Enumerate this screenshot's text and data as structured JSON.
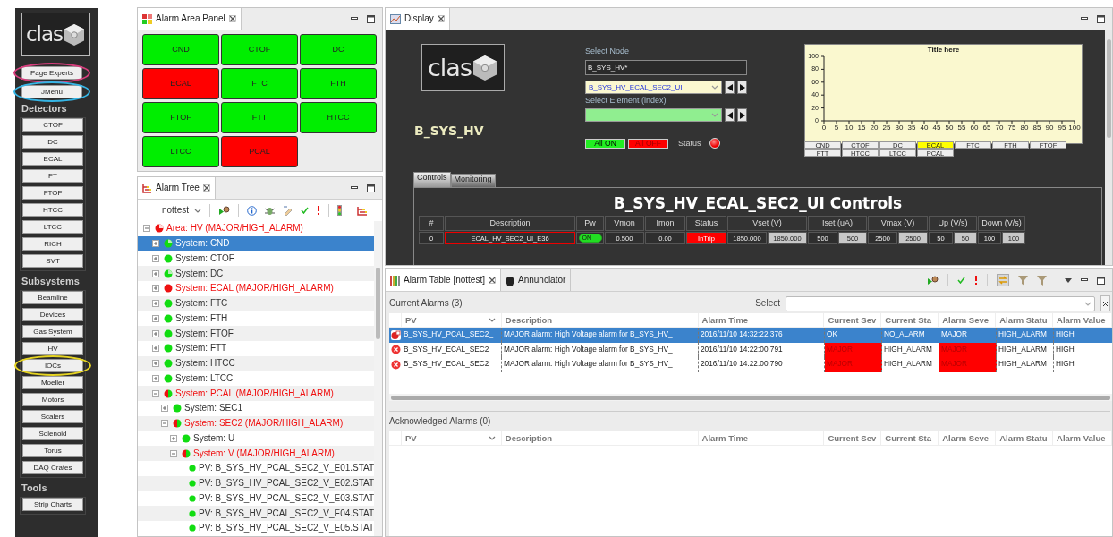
{
  "sidebar": {
    "logo": "clas",
    "buttons": [
      {
        "label": "Page Experts",
        "color": "#d63d7c"
      },
      {
        "label": "JMenu",
        "color": "#35b5e5"
      }
    ],
    "groups": [
      {
        "title": "Detectors",
        "buttons": [
          {
            "label": "CTOF"
          },
          {
            "label": "DC"
          },
          {
            "label": "ECAL"
          },
          {
            "label": "FT"
          },
          {
            "label": "FTOF"
          },
          {
            "label": "HTCC"
          },
          {
            "label": "LTCC"
          },
          {
            "label": "RICH"
          },
          {
            "label": "SVT"
          }
        ]
      },
      {
        "title": "Subsystems",
        "buttons": [
          {
            "label": "Beamline"
          },
          {
            "label": "Devices"
          },
          {
            "label": "Gas System"
          },
          {
            "label": "HV"
          },
          {
            "label": "IOCs",
            "color": "#e6d422"
          },
          {
            "label": "Moeller"
          },
          {
            "label": "Motors"
          },
          {
            "label": "Scalers"
          },
          {
            "label": "Solenoid"
          },
          {
            "label": "Torus"
          },
          {
            "label": "DAQ Crates"
          }
        ]
      },
      {
        "title": "Tools",
        "buttons": [
          {
            "label": "Strip Charts"
          }
        ]
      }
    ]
  },
  "alarm_area_panel": {
    "title": "Alarm Area Panel",
    "areas": [
      {
        "label": "CND",
        "alarm": false
      },
      {
        "label": "CTOF",
        "alarm": false
      },
      {
        "label": "DC",
        "alarm": false
      },
      {
        "label": "ECAL",
        "alarm": true
      },
      {
        "label": "FTC",
        "alarm": false
      },
      {
        "label": "FTH",
        "alarm": false
      },
      {
        "label": "FTOF",
        "alarm": false
      },
      {
        "label": "FTT",
        "alarm": false
      },
      {
        "label": "HTCC",
        "alarm": false
      },
      {
        "label": "LTCC",
        "alarm": false
      },
      {
        "label": "PCAL",
        "alarm": true
      }
    ]
  },
  "alarm_tree": {
    "title": "Alarm Tree",
    "config": "nottest",
    "items": [
      {
        "label": "Area: HV (MAJOR/HIGH_ALARM)",
        "kind": "major_partial",
        "alarm": true,
        "expanded": true,
        "selected": false,
        "children": [
          {
            "label": "System: CND",
            "kind": "ok_partial",
            "alarm": false,
            "expanded": false,
            "selected": true
          },
          {
            "label": "System: CTOF",
            "kind": "ok",
            "alarm": false,
            "expanded": false,
            "selected": false
          },
          {
            "label": "System: DC",
            "kind": "ok_partial",
            "alarm": false,
            "expanded": false,
            "selected": false
          },
          {
            "label": "System: ECAL (MAJOR/HIGH_ALARM)",
            "kind": "major",
            "alarm": true,
            "expanded": false,
            "selected": false
          },
          {
            "label": "System: FTC",
            "kind": "ok",
            "alarm": false,
            "expanded": false,
            "selected": false
          },
          {
            "label": "System: FTH",
            "kind": "ok",
            "alarm": false,
            "expanded": false,
            "selected": false
          },
          {
            "label": "System: FTOF",
            "kind": "ok",
            "alarm": false,
            "expanded": false,
            "selected": false
          },
          {
            "label": "System: FTT",
            "kind": "ok",
            "alarm": false,
            "expanded": false,
            "selected": false
          },
          {
            "label": "System: HTCC",
            "kind": "ok",
            "alarm": false,
            "expanded": false,
            "selected": false
          },
          {
            "label": "System: LTCC",
            "kind": "ok",
            "alarm": false,
            "expanded": false,
            "selected": false
          },
          {
            "label": "System: PCAL (MAJOR/HIGH_ALARM)",
            "kind": "mixed",
            "alarm": true,
            "expanded": true,
            "selected": false,
            "children": [
              {
                "label": "System: SEC1",
                "kind": "ok",
                "alarm": false,
                "expanded": false,
                "selected": false
              },
              {
                "label": "System: SEC2 (MAJOR/HIGH_ALARM)",
                "kind": "mixed",
                "alarm": true,
                "expanded": true,
                "selected": false,
                "children": [
                  {
                    "label": "System: U",
                    "kind": "ok",
                    "alarm": false,
                    "expanded": false,
                    "selected": false
                  },
                  {
                    "label": "System: V (MAJOR/HIGH_ALARM)",
                    "kind": "mixed",
                    "alarm": true,
                    "expanded": true,
                    "selected": false,
                    "children": [
                      {
                        "label": "PV: B_SYS_HV_PCAL_SEC2_V_E01.STAT",
                        "kind": "ok",
                        "alarm": false,
                        "selected": false
                      },
                      {
                        "label": "PV: B_SYS_HV_PCAL_SEC2_V_E02.STAT",
                        "kind": "ok",
                        "alarm": false,
                        "selected": false
                      },
                      {
                        "label": "PV: B_SYS_HV_PCAL_SEC2_V_E03.STAT",
                        "kind": "ok",
                        "alarm": false,
                        "selected": false
                      },
                      {
                        "label": "PV: B_SYS_HV_PCAL_SEC2_V_E04.STAT",
                        "kind": "ok",
                        "alarm": false,
                        "selected": false
                      },
                      {
                        "label": "PV: B_SYS_HV_PCAL_SEC2_V_E05.STAT",
                        "kind": "ok",
                        "alarm": false,
                        "selected": false
                      }
                    ]
                  }
                ]
              }
            ]
          }
        ]
      }
    ]
  },
  "display": {
    "title": "Display",
    "logo": "clas",
    "node_name": "B_SYS_HV",
    "select_node_label": "Select Node",
    "node_filter": "B_SYS_HV*",
    "node_choice": "B_SYS_HV_ECAL_SEC2_UI",
    "select_element_label": "Select Element (index)",
    "all_on": "All ON",
    "all_off": "All OFF",
    "status_label": "Status",
    "status_alarm": true,
    "chart_data": {
      "type": "line",
      "title": "Title here",
      "xlim": [
        0,
        100
      ],
      "ylim": [
        0,
        100
      ],
      "xticks": [
        0,
        5,
        10,
        15,
        20,
        25,
        30,
        35,
        40,
        45,
        50,
        55,
        60,
        65,
        70,
        75,
        80,
        85,
        90,
        95,
        100
      ],
      "yticks": [
        0,
        20,
        40,
        60,
        80,
        100
      ]
    },
    "detector_buttons": [
      {
        "label": "CND",
        "selected": false
      },
      {
        "label": "CTOF",
        "selected": false
      },
      {
        "label": "DC",
        "selected": false
      },
      {
        "label": "ECAL",
        "selected": true
      },
      {
        "label": "FTC",
        "selected": false
      },
      {
        "label": "FTH",
        "selected": false
      },
      {
        "label": "FTOF",
        "selected": false
      },
      {
        "label": "FTT",
        "selected": false
      },
      {
        "label": "HTCC",
        "selected": false
      },
      {
        "label": "LTCC",
        "selected": false
      },
      {
        "label": "PCAL",
        "selected": false
      }
    ],
    "tabs": [
      {
        "label": "Controls",
        "selected": true
      },
      {
        "label": "Monitoring",
        "selected": false
      }
    ],
    "controls": {
      "title": "B_SYS_HV_ECAL_SEC2_UI Controls",
      "columns": [
        "#",
        "Description",
        "Pw",
        "Vmon",
        "Imon",
        "Status",
        "Vset (V)",
        "Iset (uA)",
        "Vmax (V)",
        "Up (V/s)",
        "Down (V/s)"
      ],
      "rows": [
        {
          "index": "0",
          "description": "ECAL_HV_SEC2_UI_E36",
          "power": "ON",
          "power_on": true,
          "vmon": "0.500",
          "imon": "0.00",
          "status": "InTrip",
          "alarm": true,
          "vset": "1850.000",
          "vset_input": "1850.000",
          "iset": "500",
          "iset_input": "500",
          "vmax": "2500",
          "vmax_input": "2500",
          "up": "50",
          "up_input": "50",
          "down": "100",
          "down_input": "100"
        }
      ]
    }
  },
  "alarm_table": {
    "tabs": [
      {
        "label": "Alarm Table [nottest]",
        "selected": true
      },
      {
        "label": "Annunciator",
        "selected": false
      }
    ],
    "current": {
      "title": "Current Alarms (3)",
      "filter_label": "Select",
      "columns": [
        "PV",
        "Description",
        "Alarm Time",
        "Current Sev",
        "Current Sta",
        "Alarm Seve",
        "Alarm Statu",
        "Alarm Value"
      ],
      "rows": [
        {
          "kind": "latched",
          "selected": true,
          "cells": [
            {
              "text": "B_SYS_HV_PCAL_SEC2_",
              "alarm": false
            },
            {
              "text": "MAJOR alarm: High Voltage alarm for B_SYS_HV_",
              "alarm": false
            },
            {
              "text": "2016/11/10 14:32:22.376",
              "alarm": false
            },
            {
              "text": "OK",
              "alarm": false
            },
            {
              "text": "NO_ALARM",
              "alarm": false
            },
            {
              "text": "MAJOR",
              "alarm": false
            },
            {
              "text": "HIGH_ALARM",
              "alarm": false
            },
            {
              "text": "HIGH",
              "alarm": false
            }
          ]
        },
        {
          "kind": "active",
          "selected": false,
          "cells": [
            {
              "text": "B_SYS_HV_ECAL_SEC2",
              "alarm": false
            },
            {
              "text": "MAJOR alarm: High Voltage alarm for B_SYS_HV_",
              "alarm": false
            },
            {
              "text": "2016/11/10 14:22:00.791",
              "alarm": false
            },
            {
              "text": "MAJOR",
              "alarm": true
            },
            {
              "text": "HIGH_ALARM",
              "alarm": false
            },
            {
              "text": "MAJOR",
              "alarm": true
            },
            {
              "text": "HIGH_ALARM",
              "alarm": false
            },
            {
              "text": "HIGH",
              "alarm": false
            }
          ]
        },
        {
          "kind": "active",
          "selected": false,
          "cells": [
            {
              "text": "B_SYS_HV_ECAL_SEC2",
              "alarm": false
            },
            {
              "text": "MAJOR alarm: High Voltage alarm for B_SYS_HV_",
              "alarm": false
            },
            {
              "text": "2016/11/10 14:22:00.790",
              "alarm": false
            },
            {
              "text": "MAJOR",
              "alarm": true
            },
            {
              "text": "HIGH_ALARM",
              "alarm": false
            },
            {
              "text": "MAJOR",
              "alarm": true
            },
            {
              "text": "HIGH_ALARM",
              "alarm": false
            },
            {
              "text": "HIGH",
              "alarm": false
            }
          ]
        }
      ]
    },
    "acknowledged": {
      "title": "Acknowledged Alarms (0)",
      "columns": [
        "PV",
        "Description",
        "Alarm Time",
        "Current Sev",
        "Current Sta",
        "Alarm Seve",
        "Alarm Statu",
        "Alarm Value"
      ]
    }
  }
}
